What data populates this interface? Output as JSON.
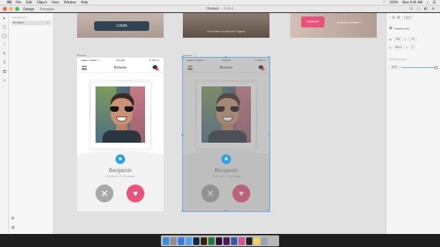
{
  "menubar": {
    "apple_glyph": "",
    "app": "XD",
    "items": [
      "File",
      "Edit",
      "Object",
      "View",
      "Window",
      "Help"
    ],
    "battery": "100%",
    "time": "Mon 9:41 AM"
  },
  "window": {
    "tabs": [
      "Design",
      "Prototype"
    ],
    "title": "Hooked",
    "status": "— Edited",
    "right_tools": [
      "⊡",
      "▢",
      "◧",
      "⊕"
    ]
  },
  "tools": [
    "▸",
    "▢",
    "◯",
    "/",
    "✎",
    "T",
    "⧉",
    "⌕"
  ],
  "layers": {
    "header": "ARTBOARD",
    "row_label": "BG layers",
    "row_count": "11",
    "bottom_icons": [
      "⚙",
      "◍"
    ]
  },
  "top_artboards": {
    "login_label": "LOGIN",
    "account_text": "Don't have an account? Signup",
    "signup_label": "SIGNUP",
    "member_text": "Already a member?"
  },
  "artboards": {
    "label1": "Browse",
    "label2": "Browse – 1"
  },
  "phone": {
    "carrier": "●●●●○ Carrier ᯤ",
    "time": "9:41 AM",
    "battery": "✦ 42% ▭",
    "nav_title": "Browse",
    "star": "★",
    "name": "Benjamin",
    "meta": "28 yrs old • 2.8 km away",
    "x": "✕",
    "heart": "♥"
  },
  "inspector": {
    "top_value": "100%",
    "repeat_grid": "Repeat Grid",
    "w_label": "W",
    "w_val": "360",
    "x_label": "X",
    "x_val": "-5.5",
    "h_label": "H",
    "h_val": "809.5",
    "y_label": "Y",
    "y_val": "0",
    "appearance": "APPEARANCE",
    "opacity": "100%"
  },
  "colors": {
    "accent_pink": "#e8537a",
    "accent_blue": "#2ea4e8",
    "login_button": "#2f4450",
    "selection": "#5aa7e0"
  },
  "dock_icons": [
    "finder",
    "launchpad",
    "safari",
    "mail",
    "photoshop",
    "illustrator",
    "excel",
    "xd",
    "muse",
    "word",
    "itunes",
    "terminal",
    "notes",
    "trash"
  ]
}
